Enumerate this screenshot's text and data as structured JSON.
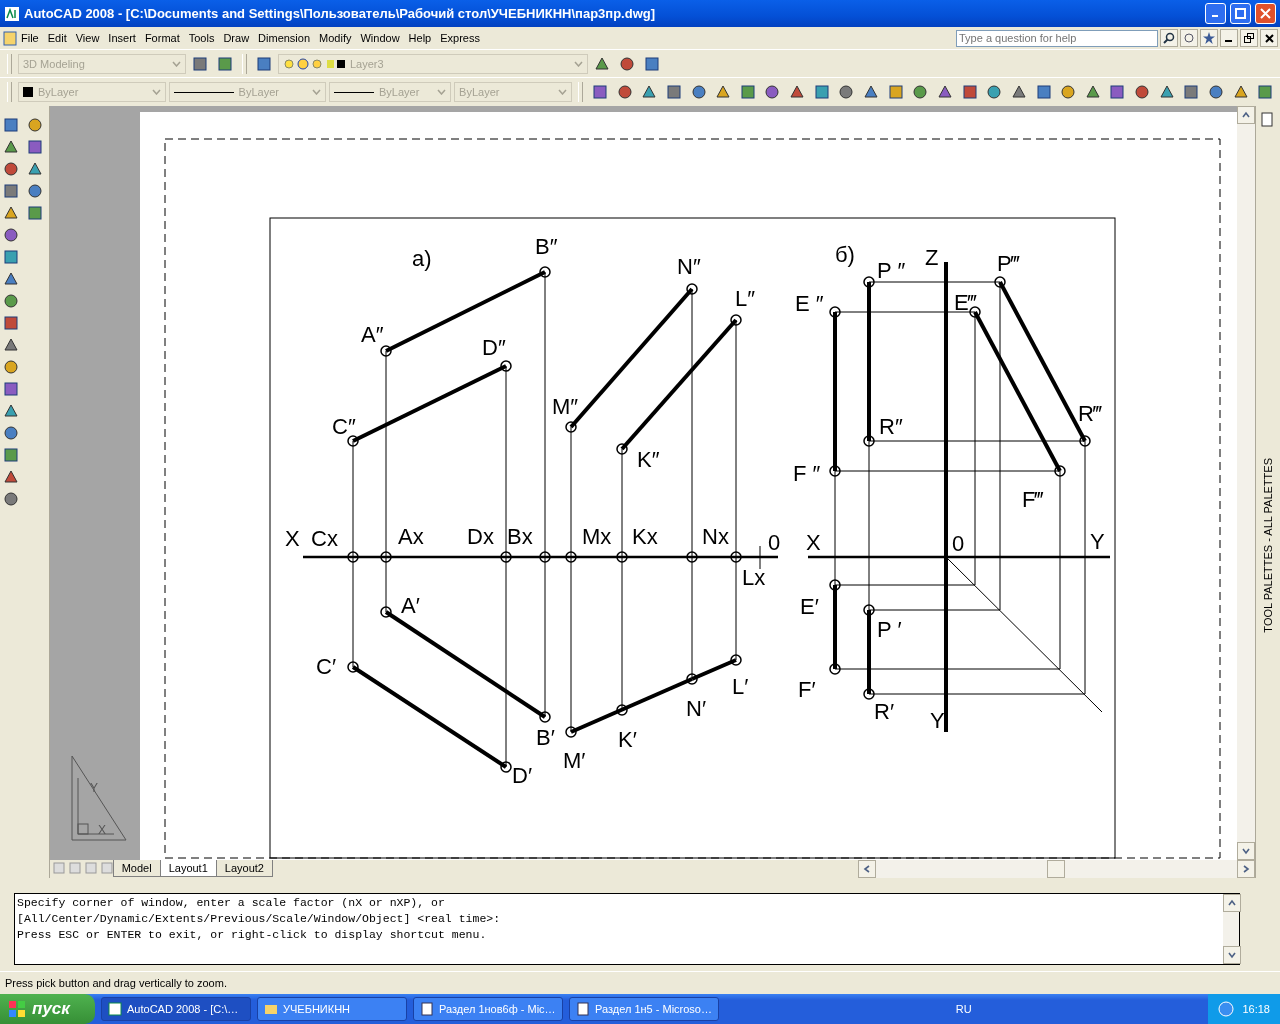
{
  "window": {
    "title": "AutoCAD 2008 - [C:\\Documents and Settings\\Пользователь\\Рабочий стол\\УЧЕБНИКНН\\пар3пр.dwg]"
  },
  "menu": [
    "File",
    "Edit",
    "View",
    "Insert",
    "Format",
    "Tools",
    "Draw",
    "Dimension",
    "Modify",
    "Window",
    "Help",
    "Express"
  ],
  "help_search": {
    "placeholder": "Type a question for help"
  },
  "workspace": {
    "value": "3D Modeling"
  },
  "layer": {
    "value": "Layer3"
  },
  "properties": [
    {
      "kind": "color",
      "value": "ByLayer"
    },
    {
      "kind": "linetype",
      "value": "ByLayer"
    },
    {
      "kind": "linetype",
      "value": "ByLayer"
    },
    {
      "kind": "plain",
      "value": "ByLayer"
    }
  ],
  "drawing": {
    "labels": [
      "а)",
      "B″",
      "A″",
      "D″",
      "C″",
      "N″",
      "L″",
      "M″",
      "K″",
      "X",
      "Cx",
      "Ax",
      "Dx",
      "Bx",
      "Mx",
      "Kx",
      "Nx",
      "0",
      "Lx",
      "A′",
      "C′",
      "B′",
      "D′",
      "M′",
      "K′",
      "N′",
      "L′",
      "б)",
      "P ″",
      "Z",
      "P‴",
      "E ″",
      "E‴",
      "R″",
      "R‴",
      "F ″",
      "F‴",
      "X",
      "0",
      "Y",
      "E′",
      "P ′",
      "F′",
      "R′",
      "Y"
    ]
  },
  "ucs_labels": [
    "Y",
    "X"
  ],
  "layout_tabs": [
    {
      "label": "Model",
      "selected": false
    },
    {
      "label": "Layout1",
      "selected": true
    },
    {
      "label": "Layout2",
      "selected": false
    }
  ],
  "command_lines": [
    "Specify corner of window, enter a scale factor (nX or nXP), or",
    "[All/Center/Dynamic/Extents/Previous/Scale/Window/Object] <real time>:",
    "Press ESC or ENTER to exit, or right-click to display shortcut menu."
  ],
  "status": "Press pick button and drag vertically to zoom.",
  "palette_title": "TOOL PALETTES - ALL PALETTES",
  "taskbar": {
    "start": "пуск",
    "tasks": [
      {
        "label": "AutoCAD 2008 - [C:\\…",
        "kind": "app",
        "selected": true
      },
      {
        "label": "УЧЕБНИКНН",
        "kind": "folder",
        "selected": false
      },
      {
        "label": "Раздел 1нов6ф - Mic…",
        "kind": "doc",
        "selected": false
      },
      {
        "label": "Раздел 1н5 - Microso…",
        "kind": "doc",
        "selected": false
      }
    ],
    "lang": "RU",
    "clock": "16:18"
  }
}
